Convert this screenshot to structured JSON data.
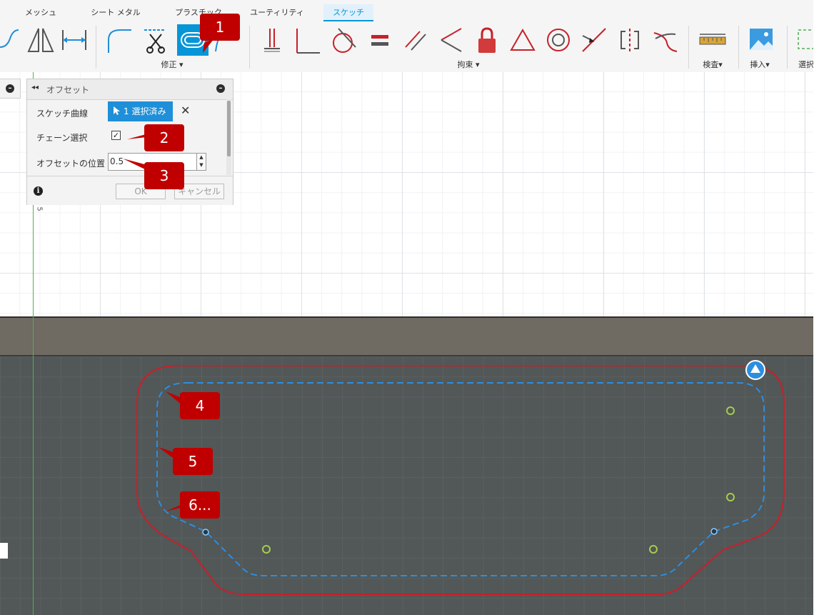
{
  "ribbon": {
    "tabs": [
      {
        "label": "メッシュ",
        "active": false
      },
      {
        "label": "シート メタル",
        "active": false
      },
      {
        "label": "プラスチック",
        "active": false
      },
      {
        "label": "ユーティリティ",
        "active": false
      },
      {
        "label": "スケッチ",
        "active": true
      }
    ],
    "groups": {
      "modify": "修正",
      "constraints": "拘束",
      "inspect": "検査",
      "insert": "挿入",
      "select": "選択"
    },
    "tools": [
      "spline-icon",
      "mirror-icon",
      "dimension-icon",
      "fillet-icon",
      "trim-icon",
      "offset-icon",
      "extend-icon",
      "horizontal-vertical-icon",
      "coincident-icon",
      "tangent-icon",
      "equal-icon",
      "parallel-icon",
      "perpendicular-icon",
      "fix-icon",
      "midpoint-icon",
      "concentric-icon",
      "collinear-icon",
      "symmetry-icon",
      "curvature-icon",
      "measure-icon",
      "insert-image-icon",
      "select-icon"
    ],
    "accent": "#0696d7"
  },
  "palette": {
    "title": "オフセット",
    "rows": {
      "sketch_curve_label": "スケッチ曲線",
      "sketch_curve_value": "1 選択済み",
      "chain_label": "チェーン選択",
      "chain_checked": true,
      "offset_label": "オフセットの位置",
      "offset_value": "0.5"
    },
    "ok_label": "OK",
    "cancel_label": "キャンセル"
  },
  "canvas": {
    "axis_mark": "5",
    "original_curve_color": "#c8202a",
    "offset_curve_color": "#2b8ee0"
  },
  "callouts": [
    "1",
    "2",
    "3",
    "4",
    "5",
    "6..."
  ],
  "callout_color": "#c00000"
}
